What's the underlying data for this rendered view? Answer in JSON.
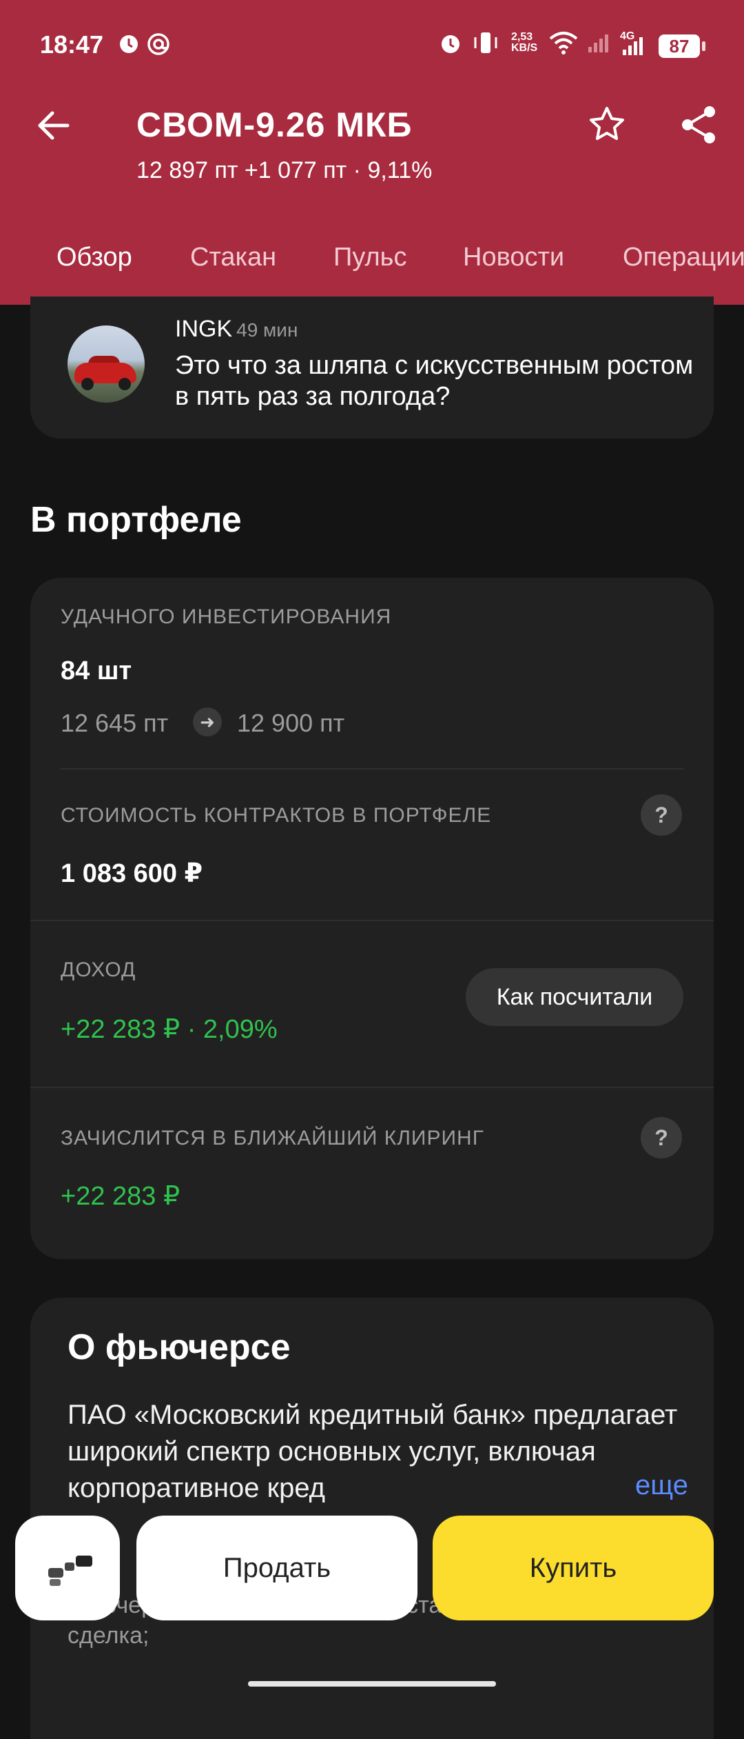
{
  "status_bar": {
    "time": "18:47",
    "net_speed": "2,53",
    "net_unit": "KB/S",
    "network_type": "4G",
    "battery": "87"
  },
  "header": {
    "title": "СВОМ-9.26 МКБ",
    "subtitle": "12 897 пт  +1 077 пт · 9,11%"
  },
  "tabs": [
    {
      "label": "Обзор",
      "active": true
    },
    {
      "label": "Стакан"
    },
    {
      "label": "Пульс"
    },
    {
      "label": "Новости"
    },
    {
      "label": "Операции"
    }
  ],
  "comment": {
    "author": "INGK",
    "age": "49 мин",
    "text": "Это что за шляпа с искусственным ростом в пять раз за полгода?"
  },
  "portfolio": {
    "section_title": "В портфеле",
    "account_label": "УДАЧНОГО ИНВЕСТИРОВАНИЯ",
    "quantity": "84 шт",
    "price_from": "12 645 пт",
    "price_to": "12 900 пт",
    "value_label": "СТОИМОСТЬ КОНТРАКТОВ В ПОРТФЕЛЕ",
    "value": "1 083 600 ₽",
    "income_label": "ДОХОД",
    "income": "+22 283 ₽ · 2,09%",
    "how_calculated": "Как посчитали",
    "clearing_label": "ЗАЧИСЛИТСЯ В БЛИЖАЙШИЙ КЛИРИНГ",
    "clearing_value": "+22 283 ₽"
  },
  "about": {
    "title": "О фьючерсе",
    "text": "ПАО «Московский кредитный банк» предлагает широкий спектр основных услуг, включая корпоративное кред",
    "more": "еще",
    "faded_text": "фьючерса — только деньги, поставочного — деньги и сделка;"
  },
  "actions": {
    "sell": "Продать",
    "buy": "Купить"
  },
  "colors": {
    "header_bg": "#a82b3f",
    "positive": "#30c24e",
    "buy_button": "#fcdd2e",
    "link": "#5b8cff"
  }
}
